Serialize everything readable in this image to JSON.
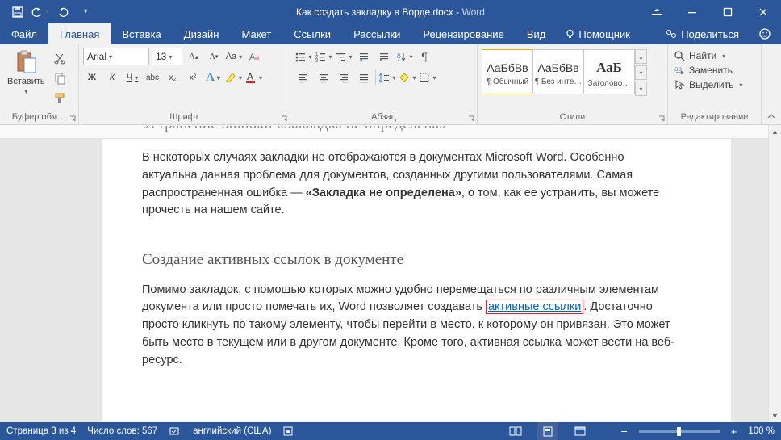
{
  "title": {
    "filename": "Как создать закладку в Ворде.docx",
    "sep": "  -  ",
    "app": "Word"
  },
  "tabs": {
    "file": "Файл",
    "home": "Главная",
    "insert": "Вставка",
    "design": "Дизайн",
    "layout": "Макет",
    "references": "Ссылки",
    "mailings": "Рассылки",
    "review": "Рецензирование",
    "view": "Вид",
    "helper": "Помощник",
    "share": "Поделиться"
  },
  "ribbon": {
    "clipboard": {
      "paste": "Вставить",
      "label": "Буфер обм…"
    },
    "font": {
      "name": "Arial",
      "size": "13",
      "label": "Шрифт",
      "bold": "Ж",
      "italic": "К",
      "underline": "Ч",
      "strike": "abc",
      "sub": "x₂",
      "sup": "x²"
    },
    "paragraph": {
      "label": "Абзац"
    },
    "styles": {
      "label": "Стили",
      "items": [
        {
          "sample": "АаБбВв",
          "name": "¶ Обычный"
        },
        {
          "sample": "АаБбВв",
          "name": "¶ Без инте…"
        },
        {
          "sample": "АаБ",
          "name": "Заголово…"
        }
      ]
    },
    "editing": {
      "find": "Найти",
      "replace": "Заменить",
      "select": "Выделить",
      "label": "Редактирование"
    }
  },
  "document": {
    "cutoff_heading": "Устранение ошибки «Закладка не определена»",
    "p1_a": "В некоторых случаях закладки не отображаются в документах Microsoft Word. Особенно актуальна данная проблема для документов, созданных другими пользователями. Самая распространенная ошибка — ",
    "p1_bold": "«Закладка не определена»",
    "p1_b": ", о том, как ее устранить, вы можете прочесть на нашем сайте.",
    "h2": "Создание активных ссылок в документе",
    "p2_a": "Помимо закладок, с помощью которых можно удобно перемещаться по различным элементам документа или просто помечать их, Word позволяет создавать ",
    "p2_link": "активные ссылки",
    "p2_b": ". Достаточно просто кликнуть по такому элементу, чтобы перейти в место, к которому он привязан. Это может быть место в текущем или в другом документе. Кроме того, активная ссылка может вести на веб-ресурс."
  },
  "status": {
    "page": "Страница 3 из 4",
    "words": "Число слов: 567",
    "lang": "английский (США)",
    "zoom": "100 %"
  }
}
